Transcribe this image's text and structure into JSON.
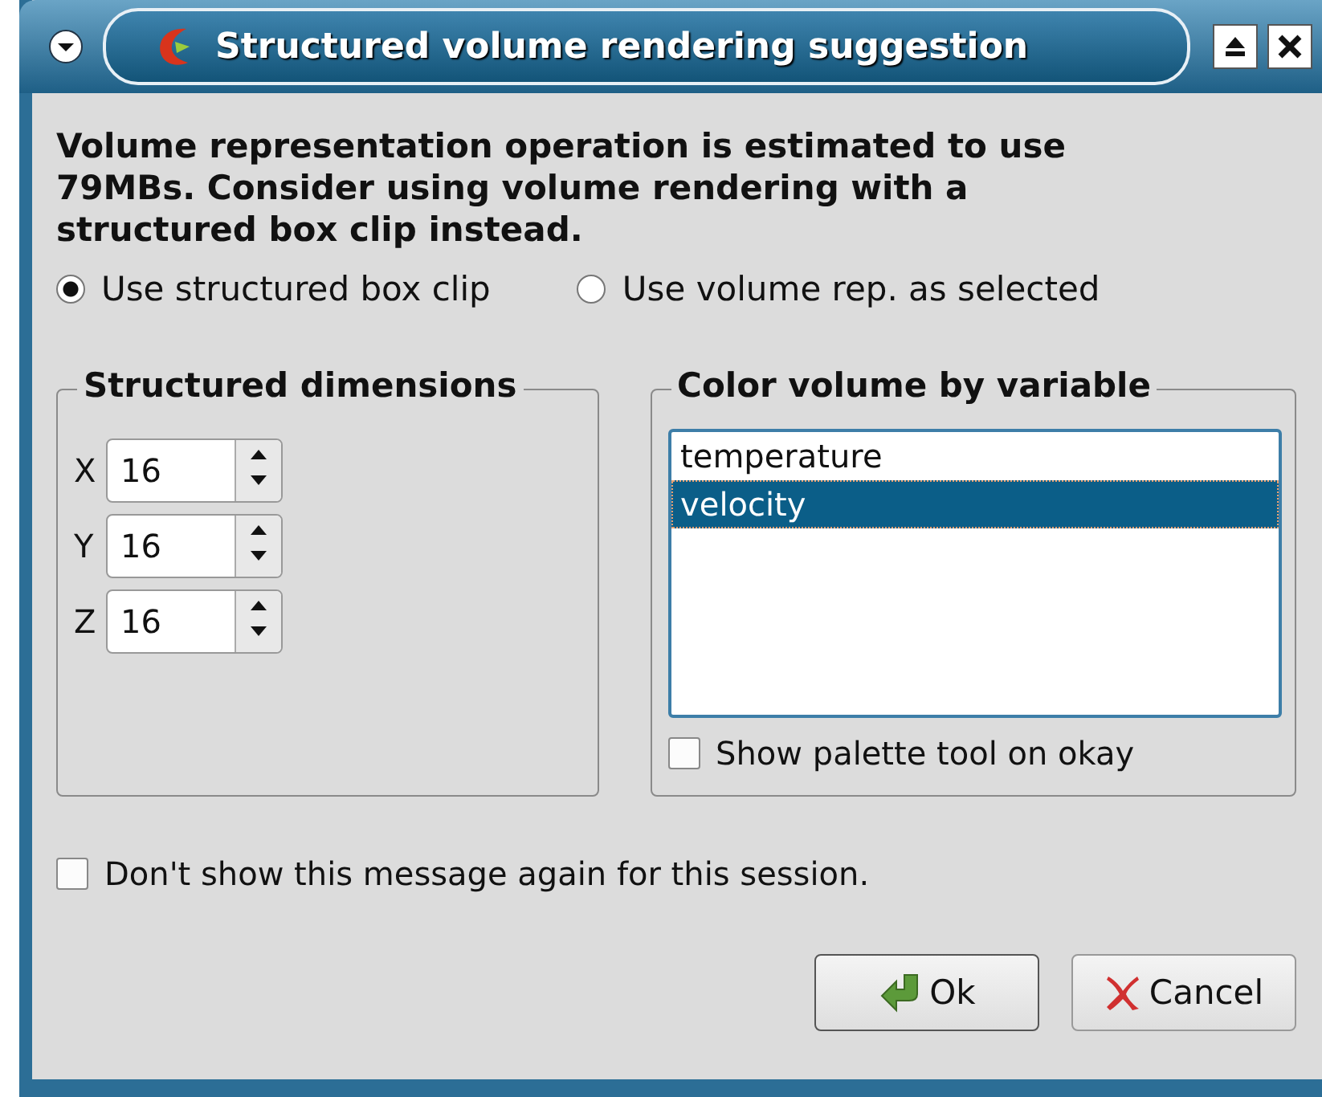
{
  "window": {
    "title": "Structured volume rendering suggestion"
  },
  "message": "Volume representation operation is estimated to use 79MBs. Consider using volume rendering with a structured box clip instead.",
  "options": [
    {
      "label": "Use structured box clip",
      "selected": true
    },
    {
      "label": "Use volume rep. as selected",
      "selected": false
    }
  ],
  "dimensions": {
    "title": "Structured dimensions",
    "fields": [
      {
        "label": "X",
        "value": "16"
      },
      {
        "label": "Y",
        "value": "16"
      },
      {
        "label": "Z",
        "value": "16"
      }
    ]
  },
  "variables": {
    "title": "Color volume by variable",
    "items": [
      {
        "label": "temperature",
        "selected": false
      },
      {
        "label": "velocity",
        "selected": true
      }
    ],
    "palette": {
      "label": "Show palette tool on okay",
      "checked": false
    }
  },
  "dont_show": {
    "label": "Don't show this message again for this session.",
    "checked": false
  },
  "buttons": [
    {
      "kind": "ok",
      "label": "Ok"
    },
    {
      "kind": "cancel",
      "label": "Cancel"
    }
  ]
}
